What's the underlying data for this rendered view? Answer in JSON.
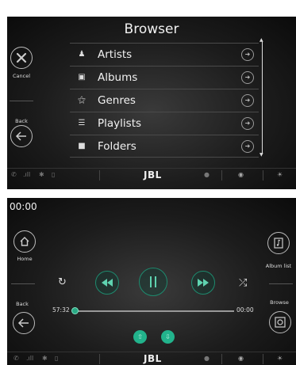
{
  "screen1": {
    "title": "Browser",
    "cancel_label": "Cancel",
    "back_label": "Back",
    "items": [
      {
        "label": "Artists",
        "icon": "person-icon"
      },
      {
        "label": "Albums",
        "icon": "album-icon"
      },
      {
        "label": "Genres",
        "icon": "genre-icon"
      },
      {
        "label": "Playlists",
        "icon": "playlist-icon"
      },
      {
        "label": "Folders",
        "icon": "folder-icon"
      }
    ],
    "brand": "JBL"
  },
  "screen2": {
    "clock": "00:00",
    "home_label": "Home",
    "album_list_label": "Album list",
    "back_label": "Back",
    "browse_label": "Browse",
    "elapsed": "57:32",
    "remaining": "00:00",
    "brand": "JBL",
    "accent_color": "#1e8a6e"
  }
}
